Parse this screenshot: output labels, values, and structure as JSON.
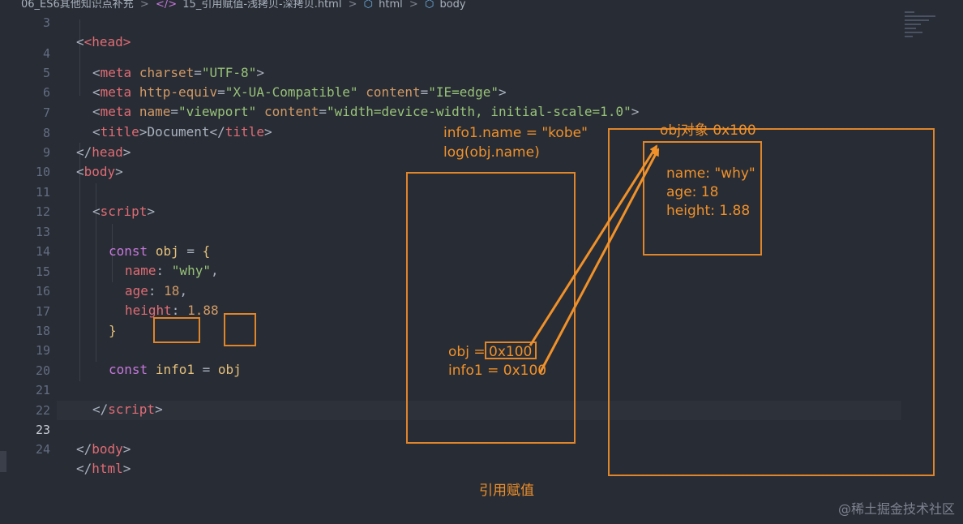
{
  "breadcrumb": {
    "folder": "06_ES6其他知识点补充",
    "file": "15_引用赋值-浅拷贝-深拷贝.html",
    "node1": "html",
    "node2": "body",
    "file_icon": "code-file-icon",
    "node_icon": "cube-icon",
    "separator": ">"
  },
  "editor": {
    "active_line": "23",
    "lines": [
      {
        "n": "3",
        "top": 0,
        "segs": [
          "<head>"
        ]
      },
      {
        "n": "4",
        "parts": {
          "open": "<",
          "tag": "meta",
          "a1": "charset",
          "eq": "=",
          "v1": "\"UTF-8\"",
          "close": ">"
        }
      },
      {
        "n": "5"
      },
      {
        "n": "6"
      },
      {
        "n": "7"
      },
      {
        "n": "8"
      },
      {
        "n": "9"
      },
      {
        "n": "10"
      },
      {
        "n": "11"
      },
      {
        "n": "12"
      },
      {
        "n": "13"
      },
      {
        "n": "14"
      },
      {
        "n": "15"
      },
      {
        "n": "16"
      },
      {
        "n": "17"
      },
      {
        "n": "18"
      },
      {
        "n": "19"
      },
      {
        "n": "20"
      },
      {
        "n": "21"
      },
      {
        "n": "22"
      },
      {
        "n": "23"
      },
      {
        "n": "24"
      }
    ],
    "code": {
      "l3": "<head>",
      "l4": {
        "tag": "meta",
        "attr": "charset",
        "val": "\"UTF-8\""
      },
      "l5": {
        "tag": "meta",
        "attr1": "http-equiv",
        "val1": "\"X-UA-Compatible\"",
        "attr2": "content",
        "val2": "\"IE=edge\""
      },
      "l6": {
        "tag": "meta",
        "attr1": "name",
        "val1": "\"viewport\"",
        "attr2": "content",
        "val2": "\"width=device-width, initial-scale=1.0\""
      },
      "l7": {
        "tag": "title",
        "text": "Document"
      },
      "l8": {
        "tag": "head"
      },
      "l9": {
        "tag": "body"
      },
      "l11": {
        "tag": "script"
      },
      "l13": {
        "kw": "const",
        "name": "obj",
        "op": "=",
        "brace": "{"
      },
      "l14": {
        "key": "name",
        "val": "\"why\"",
        "comma": ","
      },
      "l15": {
        "key": "age",
        "val": "18",
        "comma": ","
      },
      "l16": {
        "key": "height",
        "val": "1.88"
      },
      "l17": {
        "brace": "}"
      },
      "l19": {
        "kw": "const",
        "name": "info1",
        "op": "=",
        "ref": "obj"
      },
      "l21": {
        "tag": "script"
      },
      "l23": {
        "tag": "body"
      },
      "l24": {
        "tag": "html"
      }
    }
  },
  "annotations": {
    "assign_line1": "info1.name = \"kobe\"",
    "assign_line2": "log(obj.name)",
    "obj_label": "obj = ",
    "obj_value": "0x100",
    "info1_label": "info1 = 0x100",
    "heap_title": "obj对象 0x100",
    "heap_name": "name: \"why\"",
    "heap_age": "age: 18",
    "heap_height": "height: 1.88",
    "caption": "引用赋值",
    "accent_color": "#f0912a"
  },
  "watermark": "@稀土掘金技术社区"
}
